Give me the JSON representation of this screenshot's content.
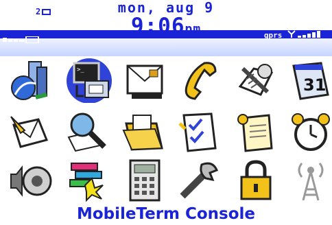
{
  "status": {
    "message_count": "2",
    "date": "mon, aug 9",
    "time": "9:06",
    "ampm": "pm",
    "network": "gprs"
  },
  "selected_app_label": "MobileTerm Console",
  "colors": {
    "accent": "#1a23d6",
    "selection": "#2f43d8"
  },
  "icons": [
    "browser-icon",
    "mobileterm-console-icon",
    "messages-icon",
    "phone-icon",
    "options-icon",
    "calendar-icon",
    "compose-icon",
    "search-icon",
    "saved-messages-icon",
    "tasks-icon",
    "memopad-icon",
    "alarm-icon",
    "profiles-icon",
    "games-icon",
    "calculator-icon",
    "settings-icon",
    "lock-icon",
    "radio-icon"
  ]
}
